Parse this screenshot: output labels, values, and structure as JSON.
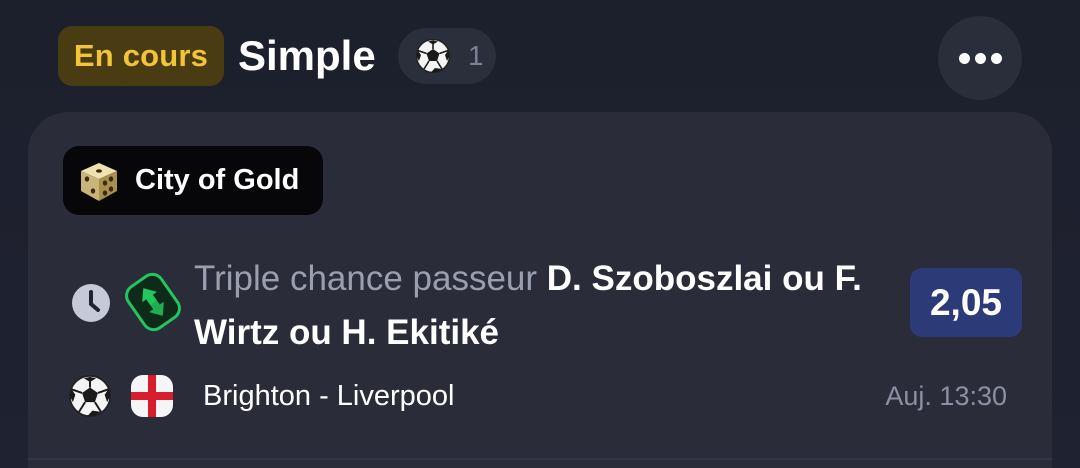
{
  "header": {
    "status": "En cours",
    "bet_type": "Simple",
    "selection_count": "1",
    "sport_icon": "soccer-ball-icon",
    "more_icon": "more-horizontal-icon"
  },
  "card": {
    "provider": {
      "name": "City of Gold",
      "icon": "dice-icon"
    },
    "selection": {
      "status_icon": "clock-icon",
      "boost_icon": "boost-arrows-icon",
      "market": "Triple chance passeur",
      "pick": "D. Szoboszlai ou F. Wirtz ou H. Ekitiké",
      "odds": "2,05"
    },
    "match": {
      "sport_icon": "soccer-ball-icon",
      "flag_icon": "england-flag-icon",
      "name": "Brighton - Liverpool",
      "time": "Auj. 13:30"
    }
  },
  "colors": {
    "status_text": "#f2c43a",
    "status_bg": "#4a3c12",
    "odds_bg": "#2d3a78",
    "boost_green": "#22c55e",
    "card_bg": "#2a2c3a"
  }
}
